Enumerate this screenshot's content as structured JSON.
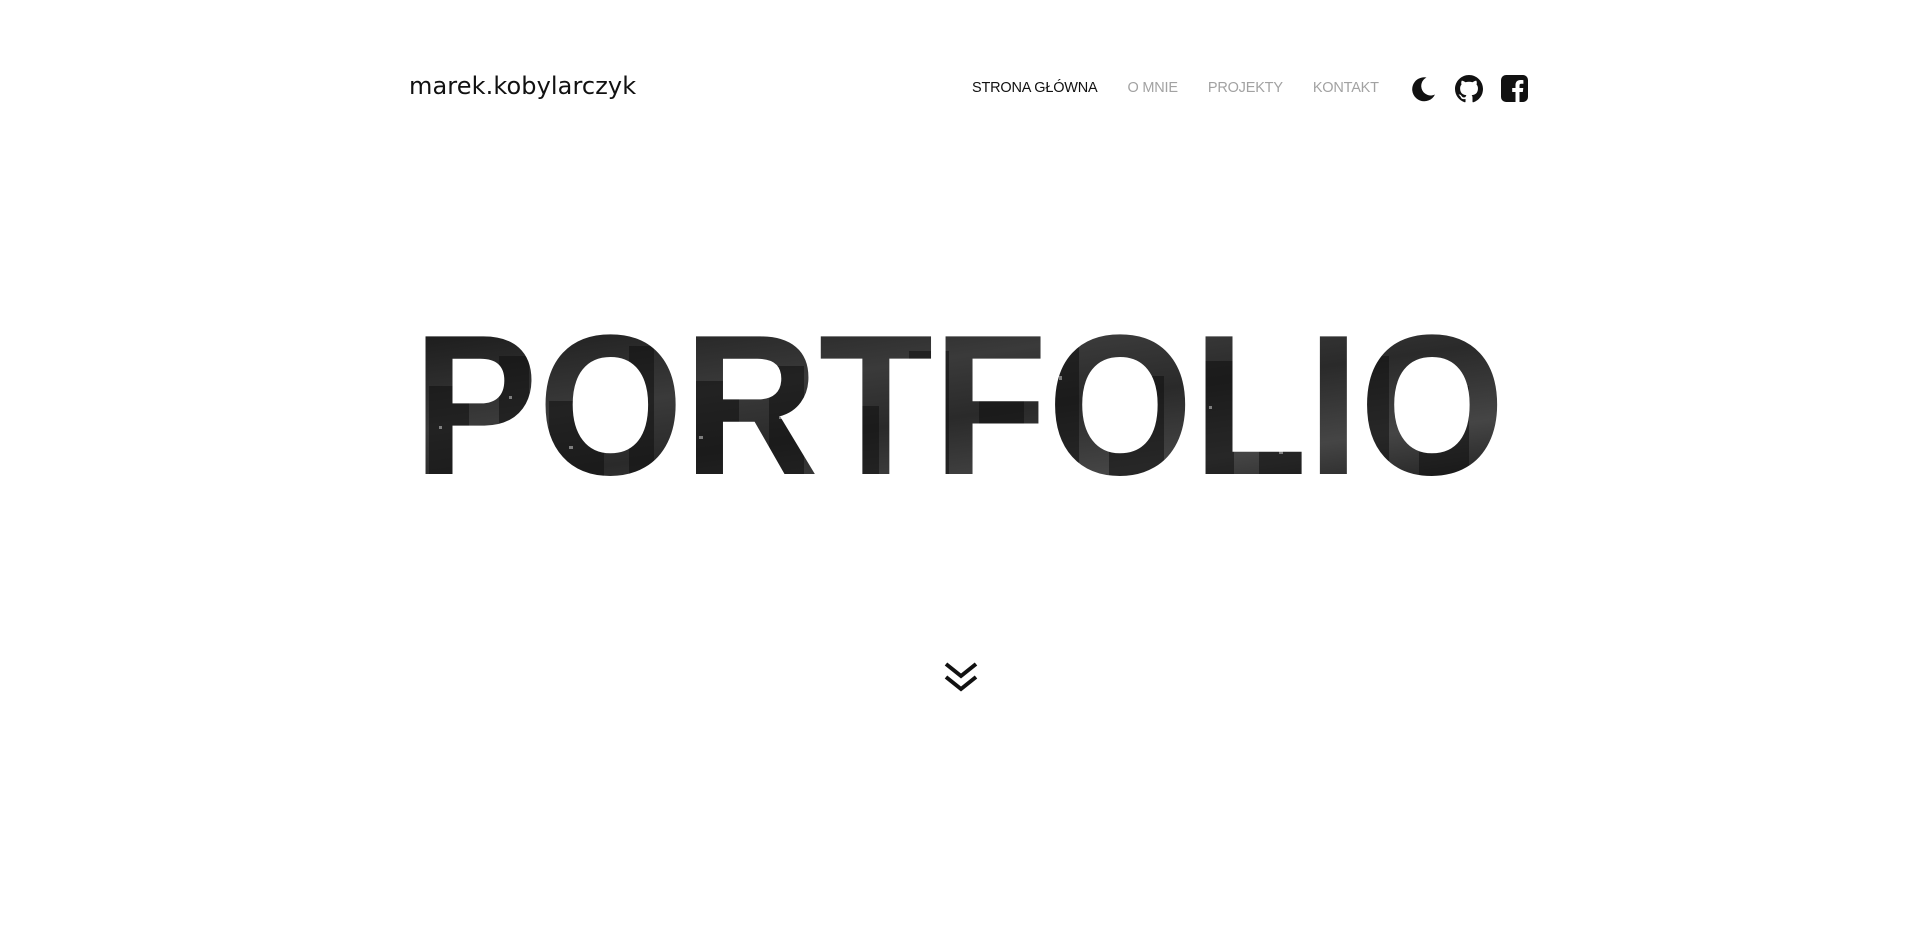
{
  "header": {
    "brand": "marek.kobylarczyk",
    "nav": [
      {
        "label": "STRONA GŁÓWNA",
        "active": true
      },
      {
        "label": "O MNIE",
        "active": false
      },
      {
        "label": "PROJEKTY",
        "active": false
      },
      {
        "label": "KONTAKT",
        "active": false
      }
    ],
    "icons": [
      "moon-icon",
      "github-icon",
      "facebook-icon"
    ]
  },
  "hero": {
    "title": "PORTFOLIO"
  },
  "scroll": {
    "icon": "double-chevron-down-icon"
  },
  "colors": {
    "text": "#111111",
    "nav_inactive": "#a2a2a2",
    "background": "#ffffff"
  }
}
